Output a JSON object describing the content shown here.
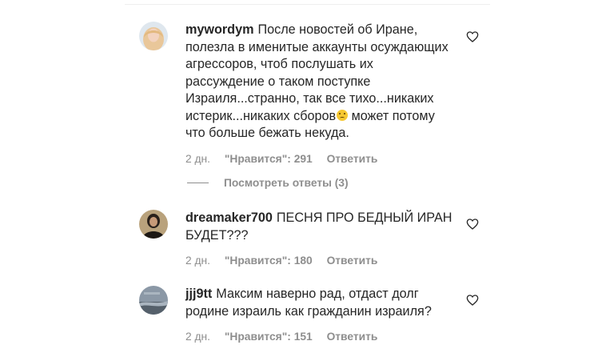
{
  "comments": [
    {
      "username": "mywordym",
      "text": "После новостей об Иране, полезла в именитые аккаунты осуждающих агрессоров, чтоб послушать их рассуждение о таком поступке Израиля...странно, так все тихо...никаких истерик...никаких сборов",
      "emoji": "pleading-face-emoji",
      "text_after": " может потому что больше бежать некуда.",
      "time": "2 дн.",
      "likes": "\"Нравится\": 291",
      "reply": "Ответить",
      "avatar_color": "#e7c6a8"
    },
    {
      "username": "dreamaker700",
      "text": "ПЕСНЯ ПРО БЕДНЫЙ ИРАН БУДЕТ???",
      "time": "2 дн.",
      "likes": "\"Нравится\": 180",
      "reply": "Ответить",
      "avatar_color": "#3b3128"
    },
    {
      "username": "jjj9tt",
      "text": "Максим наверно рад, отдаст долг родине израиль как гражданин израиля?",
      "time": "2 дн.",
      "likes": "\"Нравится\": 151",
      "reply": "Ответить",
      "avatar_color": "#7e8c99"
    }
  ],
  "view_replies": {
    "label": "Посмотреть ответы (3)"
  },
  "icons": {
    "heart": "heart-outline-icon"
  }
}
